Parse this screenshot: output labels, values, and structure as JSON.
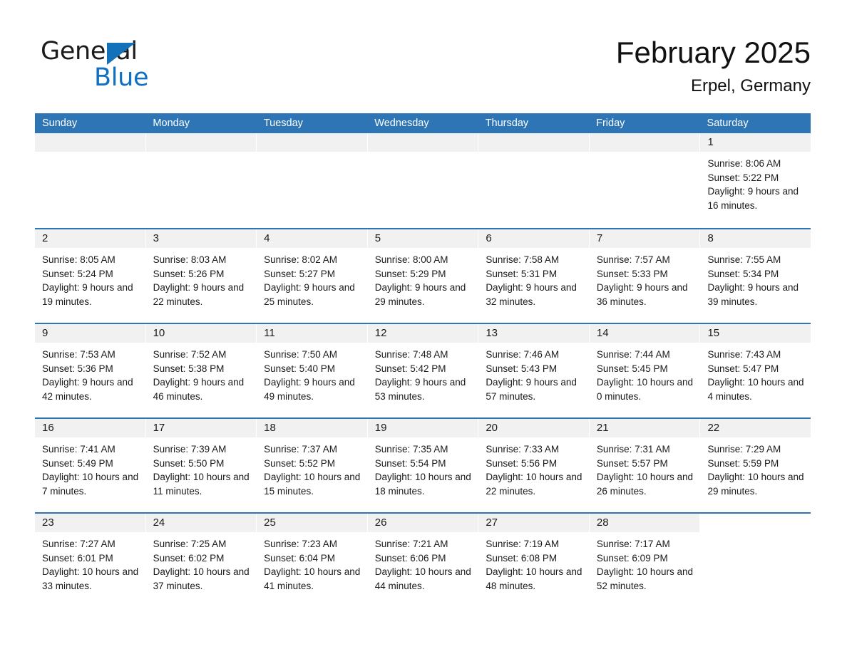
{
  "brand": {
    "name_part1": "General",
    "name_part2": "Blue",
    "triangle_icon": "brand-triangle-icon",
    "accent_color": "#1271b8"
  },
  "header": {
    "title": "February 2025",
    "subtitle": "Erpel, Germany"
  },
  "theme": {
    "header_blue": "#2e75b6",
    "row_divider_blue": "#2e75b6",
    "day_band_gray": "#f1f1f1"
  },
  "calendar": {
    "weekday_headers": [
      "Sunday",
      "Monday",
      "Tuesday",
      "Wednesday",
      "Thursday",
      "Friday",
      "Saturday"
    ],
    "weeks": [
      [
        {
          "day": "",
          "empty": true
        },
        {
          "day": "",
          "empty": true
        },
        {
          "day": "",
          "empty": true
        },
        {
          "day": "",
          "empty": true
        },
        {
          "day": "",
          "empty": true
        },
        {
          "day": "",
          "empty": true
        },
        {
          "day": "1",
          "sunrise": "Sunrise: 8:06 AM",
          "sunset": "Sunset: 5:22 PM",
          "daylight": "Daylight: 9 hours and 16 minutes."
        }
      ],
      [
        {
          "day": "2",
          "sunrise": "Sunrise: 8:05 AM",
          "sunset": "Sunset: 5:24 PM",
          "daylight": "Daylight: 9 hours and 19 minutes."
        },
        {
          "day": "3",
          "sunrise": "Sunrise: 8:03 AM",
          "sunset": "Sunset: 5:26 PM",
          "daylight": "Daylight: 9 hours and 22 minutes."
        },
        {
          "day": "4",
          "sunrise": "Sunrise: 8:02 AM",
          "sunset": "Sunset: 5:27 PM",
          "daylight": "Daylight: 9 hours and 25 minutes."
        },
        {
          "day": "5",
          "sunrise": "Sunrise: 8:00 AM",
          "sunset": "Sunset: 5:29 PM",
          "daylight": "Daylight: 9 hours and 29 minutes."
        },
        {
          "day": "6",
          "sunrise": "Sunrise: 7:58 AM",
          "sunset": "Sunset: 5:31 PM",
          "daylight": "Daylight: 9 hours and 32 minutes."
        },
        {
          "day": "7",
          "sunrise": "Sunrise: 7:57 AM",
          "sunset": "Sunset: 5:33 PM",
          "daylight": "Daylight: 9 hours and 36 minutes."
        },
        {
          "day": "8",
          "sunrise": "Sunrise: 7:55 AM",
          "sunset": "Sunset: 5:34 PM",
          "daylight": "Daylight: 9 hours and 39 minutes."
        }
      ],
      [
        {
          "day": "9",
          "sunrise": "Sunrise: 7:53 AM",
          "sunset": "Sunset: 5:36 PM",
          "daylight": "Daylight: 9 hours and 42 minutes."
        },
        {
          "day": "10",
          "sunrise": "Sunrise: 7:52 AM",
          "sunset": "Sunset: 5:38 PM",
          "daylight": "Daylight: 9 hours and 46 minutes."
        },
        {
          "day": "11",
          "sunrise": "Sunrise: 7:50 AM",
          "sunset": "Sunset: 5:40 PM",
          "daylight": "Daylight: 9 hours and 49 minutes."
        },
        {
          "day": "12",
          "sunrise": "Sunrise: 7:48 AM",
          "sunset": "Sunset: 5:42 PM",
          "daylight": "Daylight: 9 hours and 53 minutes."
        },
        {
          "day": "13",
          "sunrise": "Sunrise: 7:46 AM",
          "sunset": "Sunset: 5:43 PM",
          "daylight": "Daylight: 9 hours and 57 minutes."
        },
        {
          "day": "14",
          "sunrise": "Sunrise: 7:44 AM",
          "sunset": "Sunset: 5:45 PM",
          "daylight": "Daylight: 10 hours and 0 minutes."
        },
        {
          "day": "15",
          "sunrise": "Sunrise: 7:43 AM",
          "sunset": "Sunset: 5:47 PM",
          "daylight": "Daylight: 10 hours and 4 minutes."
        }
      ],
      [
        {
          "day": "16",
          "sunrise": "Sunrise: 7:41 AM",
          "sunset": "Sunset: 5:49 PM",
          "daylight": "Daylight: 10 hours and 7 minutes."
        },
        {
          "day": "17",
          "sunrise": "Sunrise: 7:39 AM",
          "sunset": "Sunset: 5:50 PM",
          "daylight": "Daylight: 10 hours and 11 minutes."
        },
        {
          "day": "18",
          "sunrise": "Sunrise: 7:37 AM",
          "sunset": "Sunset: 5:52 PM",
          "daylight": "Daylight: 10 hours and 15 minutes."
        },
        {
          "day": "19",
          "sunrise": "Sunrise: 7:35 AM",
          "sunset": "Sunset: 5:54 PM",
          "daylight": "Daylight: 10 hours and 18 minutes."
        },
        {
          "day": "20",
          "sunrise": "Sunrise: 7:33 AM",
          "sunset": "Sunset: 5:56 PM",
          "daylight": "Daylight: 10 hours and 22 minutes."
        },
        {
          "day": "21",
          "sunrise": "Sunrise: 7:31 AM",
          "sunset": "Sunset: 5:57 PM",
          "daylight": "Daylight: 10 hours and 26 minutes."
        },
        {
          "day": "22",
          "sunrise": "Sunrise: 7:29 AM",
          "sunset": "Sunset: 5:59 PM",
          "daylight": "Daylight: 10 hours and 29 minutes."
        }
      ],
      [
        {
          "day": "23",
          "sunrise": "Sunrise: 7:27 AM",
          "sunset": "Sunset: 6:01 PM",
          "daylight": "Daylight: 10 hours and 33 minutes."
        },
        {
          "day": "24",
          "sunrise": "Sunrise: 7:25 AM",
          "sunset": "Sunset: 6:02 PM",
          "daylight": "Daylight: 10 hours and 37 minutes."
        },
        {
          "day": "25",
          "sunrise": "Sunrise: 7:23 AM",
          "sunset": "Sunset: 6:04 PM",
          "daylight": "Daylight: 10 hours and 41 minutes."
        },
        {
          "day": "26",
          "sunrise": "Sunrise: 7:21 AM",
          "sunset": "Sunset: 6:06 PM",
          "daylight": "Daylight: 10 hours and 44 minutes."
        },
        {
          "day": "27",
          "sunrise": "Sunrise: 7:19 AM",
          "sunset": "Sunset: 6:08 PM",
          "daylight": "Daylight: 10 hours and 48 minutes."
        },
        {
          "day": "28",
          "sunrise": "Sunrise: 7:17 AM",
          "sunset": "Sunset: 6:09 PM",
          "daylight": "Daylight: 10 hours and 52 minutes."
        },
        {
          "day": "",
          "empty": true,
          "noband": true
        }
      ]
    ]
  }
}
